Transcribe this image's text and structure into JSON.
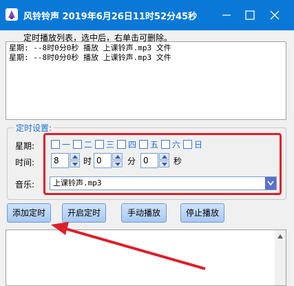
{
  "window": {
    "title": "风铃铃声  2019年6月26日11时52分45秒"
  },
  "playlist": {
    "label": "定时播放列表，选中后，右单击可删除。",
    "items": [
      "星期: --8时0分0秒 播放 上课铃声.mp3 文件",
      "星期: --8时0分0秒 播放 上课铃声.mp3 文件"
    ]
  },
  "settings": {
    "group_title": "定时设置:",
    "week_label": "星期:",
    "weekdays": [
      "一",
      "二",
      "三",
      "四",
      "五",
      "六",
      "日"
    ],
    "time_label": "时间:",
    "hour_value": "8",
    "hour_unit": "时",
    "minute_value": "0",
    "minute_unit": "分",
    "second_value": "0",
    "second_unit": "秒",
    "music_label": "音乐:",
    "music_value": "上课铃声.mp3"
  },
  "buttons": {
    "add": "添加定时",
    "start": "开启定时",
    "manual": "手动播放",
    "stop": "停止播放"
  },
  "colors": {
    "titlebar": "#0a78d7",
    "highlight": "#dd1f2a",
    "accent_text": "#1a6fd6"
  }
}
